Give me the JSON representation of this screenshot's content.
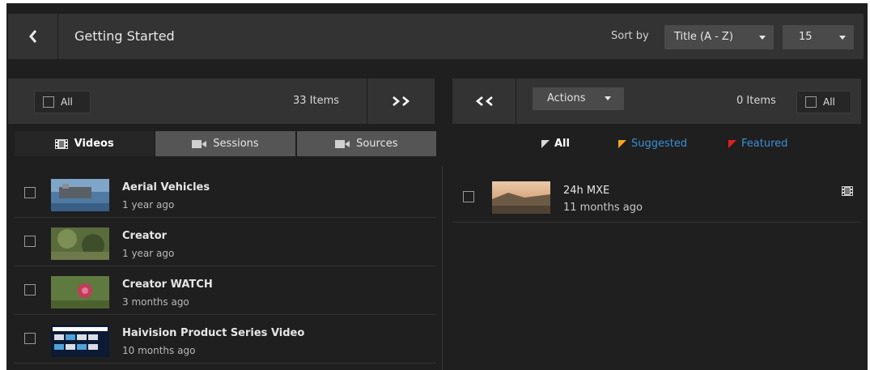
{
  "header": {
    "title": "Getting Started",
    "sort_label": "Sort by",
    "sort_value": "Title (A - Z)",
    "page_size": "15"
  },
  "library": {
    "select_all_label": "All",
    "count": "33 Items",
    "tabs": [
      {
        "label": "Videos",
        "icon": "film-icon",
        "active": true
      },
      {
        "label": "Sessions",
        "icon": "camera-icon",
        "active": false
      },
      {
        "label": "Sources",
        "icon": "camera-icon",
        "active": false
      }
    ],
    "items": [
      {
        "title": "Aerial Vehicles",
        "age": "1 year ago"
      },
      {
        "title": "Creator",
        "age": "1 year ago"
      },
      {
        "title": "Creator WATCH",
        "age": "3 months ago"
      },
      {
        "title": "Haivision Product Series Video",
        "age": "10 months ago"
      }
    ]
  },
  "selection": {
    "actions_label": "Actions",
    "count": "0 Items",
    "select_all_label": "All",
    "filters": [
      {
        "label": "All",
        "color": "#d8d8d8"
      },
      {
        "label": "Suggested",
        "color": "#f5a623"
      },
      {
        "label": "Featured",
        "color": "#e02020"
      }
    ],
    "items": [
      {
        "title": "24h MXE",
        "age": "11 months ago"
      }
    ]
  },
  "colors": {
    "background": "#1f1f1f",
    "bar": "#333333",
    "link": "#3b8fd6"
  }
}
